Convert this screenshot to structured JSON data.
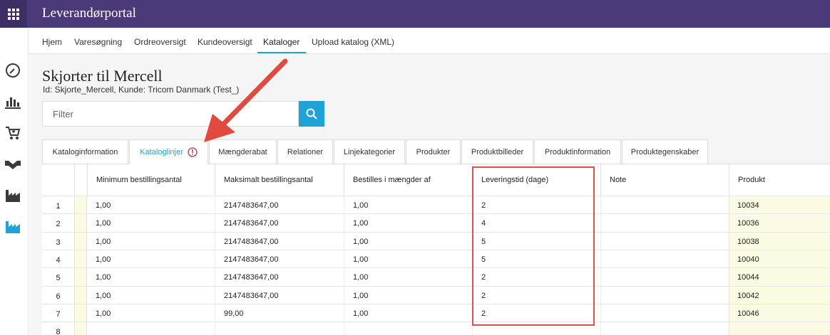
{
  "app": {
    "title": "Leverandørportal"
  },
  "rail": {
    "icons": [
      "dashboard-icon",
      "bar-chart-icon",
      "cart-icon",
      "handshake-icon",
      "factory-icon",
      "factory-active-icon"
    ]
  },
  "nav": {
    "items": [
      {
        "label": "Hjem"
      },
      {
        "label": "Varesøgning"
      },
      {
        "label": "Ordreoversigt"
      },
      {
        "label": "Kundeoversigt"
      },
      {
        "label": "Kataloger"
      },
      {
        "label": "Upload katalog (XML)"
      }
    ],
    "active": "Kataloger"
  },
  "page": {
    "title": "Skjorter til Mercell",
    "subtitle": "Id: Skjorte_Mercell, Kunde: Tricom Danmark (Test_)"
  },
  "filter": {
    "placeholder": "Filter"
  },
  "tabs": [
    {
      "label": "Kataloginformation"
    },
    {
      "label": "Kataloglinjer"
    },
    {
      "label": "Mængderabat"
    },
    {
      "label": "Relationer"
    },
    {
      "label": "Linjekategorier"
    },
    {
      "label": "Produkter"
    },
    {
      "label": "Produktbilleder"
    },
    {
      "label": "Produktinformation"
    },
    {
      "label": "Produktegenskaber"
    }
  ],
  "table": {
    "columns": [
      "Minimum bestillingsantal",
      "Maksimalt bestillingsantal",
      "Bestilles i mængder af",
      "Leveringstid (dage)",
      "Note",
      "Produkt"
    ],
    "rows": [
      {
        "num": "1",
        "min": "1,00",
        "max": "2147483647,00",
        "multiple": "1,00",
        "lead": "2",
        "note": "",
        "product": "10034"
      },
      {
        "num": "2",
        "min": "1,00",
        "max": "2147483647,00",
        "multiple": "1,00",
        "lead": "4",
        "note": "",
        "product": "10036"
      },
      {
        "num": "3",
        "min": "1,00",
        "max": "2147483647,00",
        "multiple": "1,00",
        "lead": "5",
        "note": "",
        "product": "10038"
      },
      {
        "num": "4",
        "min": "1,00",
        "max": "2147483647,00",
        "multiple": "1,00",
        "lead": "5",
        "note": "",
        "product": "10040"
      },
      {
        "num": "5",
        "min": "1,00",
        "max": "2147483647,00",
        "multiple": "1,00",
        "lead": "2",
        "note": "",
        "product": "10044"
      },
      {
        "num": "6",
        "min": "1,00",
        "max": "2147483647,00",
        "multiple": "1,00",
        "lead": "2",
        "note": "",
        "product": "10042"
      },
      {
        "num": "7",
        "min": "1,00",
        "max": "99,00",
        "multiple": "1,00",
        "lead": "2",
        "note": "",
        "product": "10046"
      },
      {
        "num": "8",
        "min": "",
        "max": "",
        "multiple": "",
        "lead": "",
        "note": "",
        "product": ""
      }
    ]
  },
  "colors": {
    "topbar": "#4b3a7a",
    "accent": "#1fa2d8",
    "highlight": "#d9534f",
    "product_bg": "#fbfbe3"
  }
}
